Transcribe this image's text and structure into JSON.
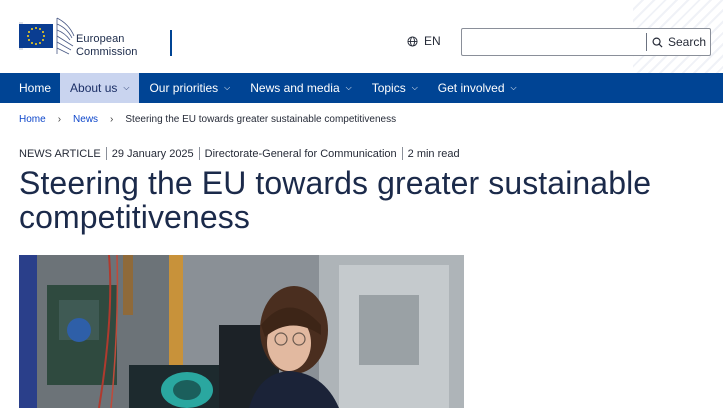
{
  "header": {
    "logo_line1": "European",
    "logo_line2": "Commission",
    "language": "EN",
    "search_placeholder": "",
    "search_button": "Search"
  },
  "nav": {
    "items": [
      {
        "label": "Home",
        "has_dropdown": false,
        "active": false
      },
      {
        "label": "About us",
        "has_dropdown": true,
        "active": true
      },
      {
        "label": "Our priorities",
        "has_dropdown": true,
        "active": false
      },
      {
        "label": "News and media",
        "has_dropdown": true,
        "active": false
      },
      {
        "label": "Topics",
        "has_dropdown": true,
        "active": false
      },
      {
        "label": "Get involved",
        "has_dropdown": true,
        "active": false
      }
    ],
    "chevron": "⌵"
  },
  "breadcrumb": {
    "items": [
      "Home",
      "News"
    ],
    "current": "Steering the EU towards greater sustainable competitiveness",
    "separator": "›"
  },
  "article": {
    "type": "NEWS ARTICLE",
    "date": "29 January 2025",
    "author": "Directorate-General for Communication",
    "read_time": "2 min read",
    "title": "Steering the EU towards greater sustainable competitiveness"
  },
  "colors": {
    "nav_bg": "#004494",
    "nav_active_bg": "#c9d4ef",
    "link": "#0e47cb",
    "title": "#1b2a4a"
  },
  "icons": {
    "globe": "globe-icon",
    "search": "search-icon",
    "flag": "eu-flag-logo"
  }
}
